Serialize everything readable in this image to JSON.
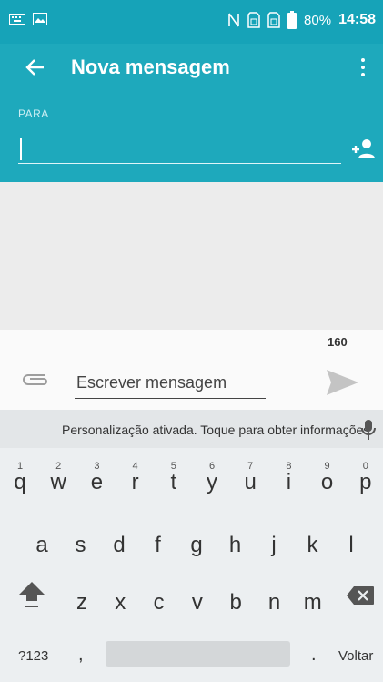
{
  "status_bar": {
    "battery": "80%",
    "time": "14:58"
  },
  "app_bar": {
    "title": "Nova mensagem"
  },
  "recipient": {
    "label": "PARA",
    "value": ""
  },
  "compose": {
    "char_counter": "160",
    "placeholder": "Escrever mensagem"
  },
  "keyboard": {
    "suggestion": "Personalização ativada. Toque para obter informações.",
    "row1": [
      {
        "num": "1",
        "ch": "q"
      },
      {
        "num": "2",
        "ch": "w"
      },
      {
        "num": "3",
        "ch": "e"
      },
      {
        "num": "4",
        "ch": "r"
      },
      {
        "num": "5",
        "ch": "t"
      },
      {
        "num": "6",
        "ch": "y"
      },
      {
        "num": "7",
        "ch": "u"
      },
      {
        "num": "8",
        "ch": "i"
      },
      {
        "num": "9",
        "ch": "o"
      },
      {
        "num": "0",
        "ch": "p"
      }
    ],
    "row2": [
      "a",
      "s",
      "d",
      "f",
      "g",
      "h",
      "j",
      "k",
      "l"
    ],
    "row3": [
      "z",
      "x",
      "c",
      "v",
      "b",
      "n",
      "m"
    ],
    "symbols_label": "?123",
    "comma": ",",
    "period": ".",
    "enter_label": "Voltar"
  },
  "colors": {
    "primary": "#1ea9bc",
    "status": "#16a3b8",
    "thread_bg": "#ececec",
    "keyboard_bg": "#eceff1"
  }
}
